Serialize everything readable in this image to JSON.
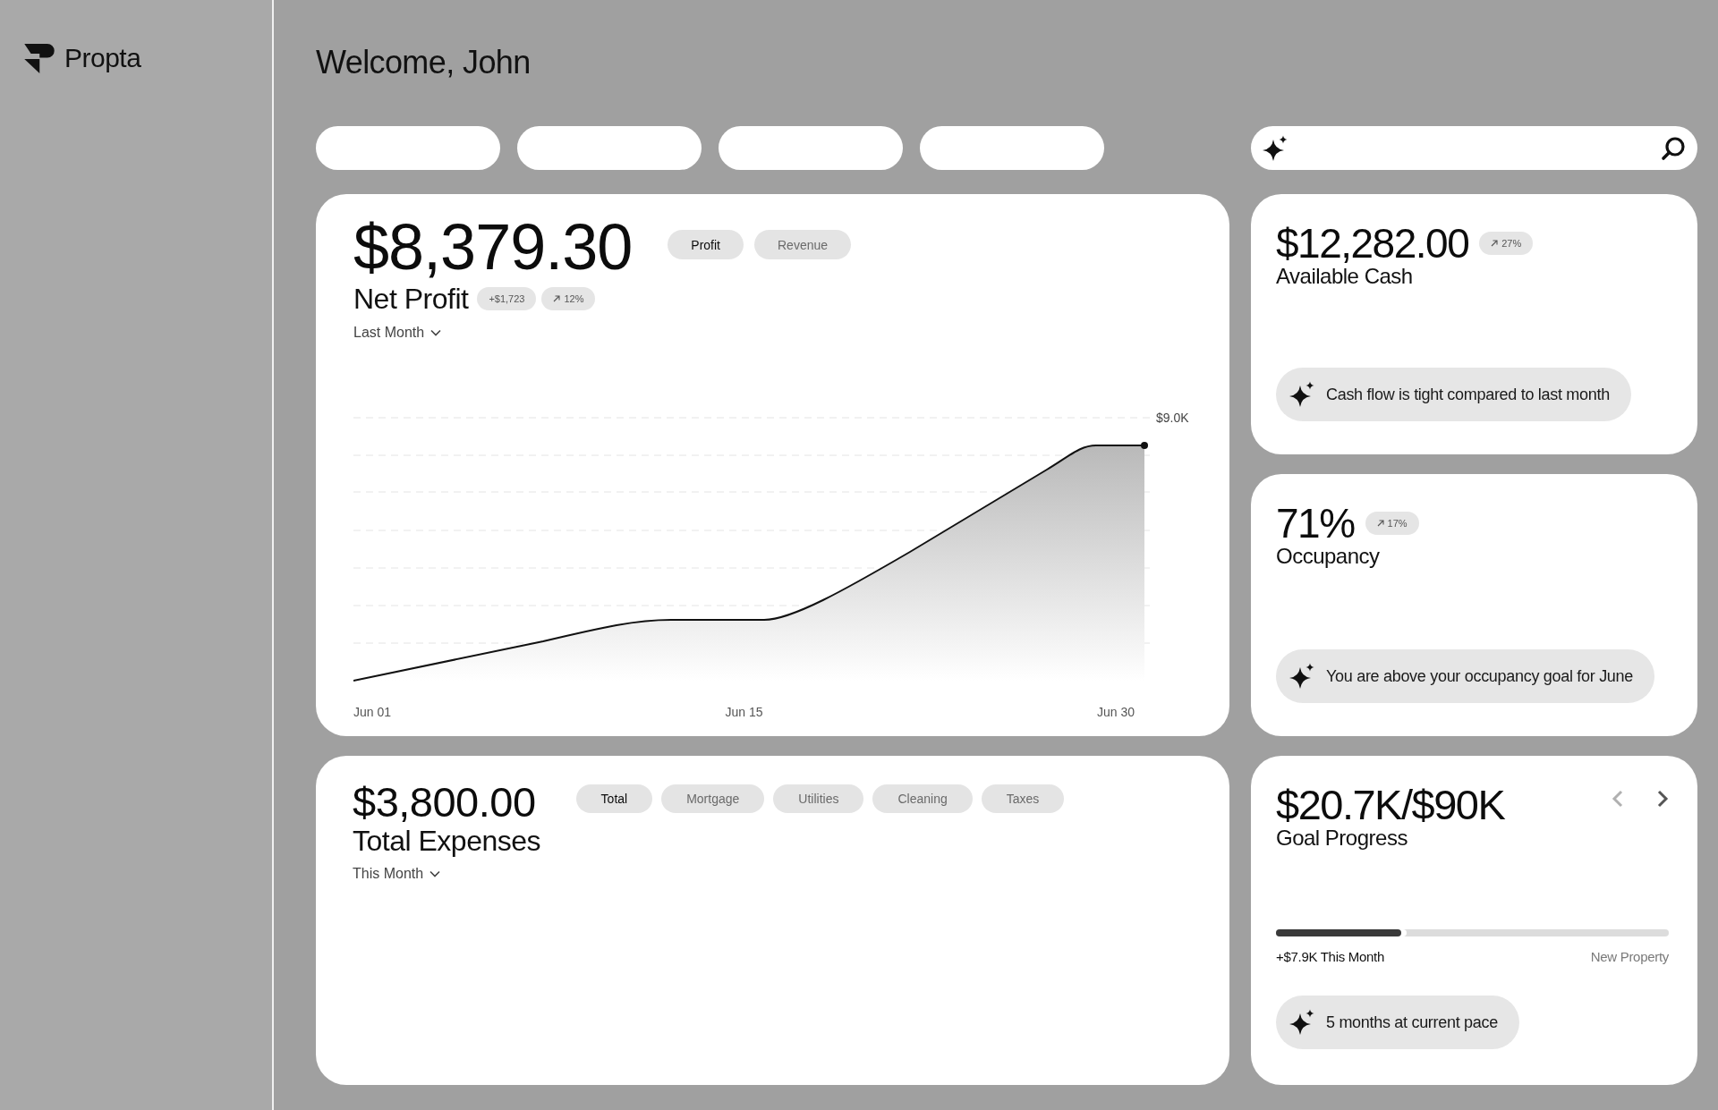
{
  "sidebar": {
    "brand": "Propta"
  },
  "header": {
    "title": "Welcome, John"
  },
  "net_profit": {
    "amount": "$8,379.30",
    "label": "Net Profit",
    "toggles": [
      {
        "label": "Profit",
        "selected": true
      },
      {
        "label": "Revenue",
        "selected": false
      }
    ],
    "badges": [
      {
        "kind": "plain",
        "text": "+$1,723"
      },
      {
        "kind": "trend",
        "text": "12%"
      }
    ],
    "period": "Last Month",
    "chart": {
      "end_label": "$9.0K",
      "x_labels": [
        "Jun 01",
        "Jun 15",
        "Jun 30"
      ]
    }
  },
  "available_cash": {
    "amount": "$12,282.00",
    "label": "Available Cash",
    "trend": "27%",
    "insight": "Cash flow is tight compared to last month"
  },
  "occupancy": {
    "amount": "71%",
    "label": "Occupancy",
    "trend": "17%",
    "insight": "You are above your occupancy goal for June"
  },
  "expenses": {
    "amount": "$3,800.00",
    "label": "Total Expenses",
    "categories": [
      {
        "label": "Total",
        "selected": true
      },
      {
        "label": "Mortgage",
        "selected": false
      },
      {
        "label": "Utilities",
        "selected": false
      },
      {
        "label": "Cleaning",
        "selected": false
      },
      {
        "label": "Taxes",
        "selected": false
      }
    ],
    "period": "This Month"
  },
  "goal": {
    "amount": "$20.7K/$90K",
    "label": "Goal Progress",
    "nav": [
      {
        "kind": "prev",
        "disabled": true
      },
      {
        "kind": "next",
        "disabled": false
      }
    ],
    "progress": {
      "level": 0.32
    },
    "caption": "+$7.9K This Month",
    "goal_name": "New Property",
    "insight": "5 months at current pace"
  }
}
